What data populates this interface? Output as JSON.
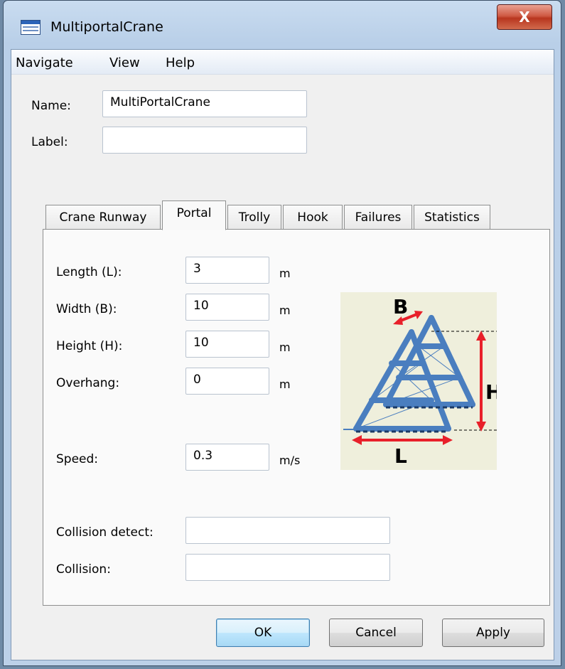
{
  "window": {
    "title": "MultiportalCrane",
    "close_glyph": "X",
    "icon": "window-app-icon"
  },
  "menu": [
    "Navigate",
    "View",
    "Help"
  ],
  "form": {
    "name_label": "Name:",
    "name_value": "MultiPortalCrane",
    "label_label": "Label:",
    "label_value": ""
  },
  "tabs": [
    "Crane Runway",
    "Portal",
    "Trolly",
    "Hook",
    "Failures",
    "Statistics"
  ],
  "active_tab": "Portal",
  "portal": {
    "length_label": "Length (L):",
    "length_value": "3",
    "length_unit": "m",
    "width_label": "Width (B):",
    "width_value": "10",
    "width_unit": "m",
    "height_label": "Height (H):",
    "height_value": "10",
    "height_unit": "m",
    "overhang_label": "Overhang:",
    "overhang_value": "0",
    "overhang_unit": "m",
    "speed_label": "Speed:",
    "speed_value": "0.3",
    "speed_unit": "m/s",
    "collision_detect_label": "Collision detect:",
    "collision_detect_value": "",
    "collision_label": "Collision:",
    "collision_value": ""
  },
  "diagram": {
    "label_b": "B",
    "label_h": "H",
    "label_l": "L",
    "colors": {
      "frame": "#4a7ebf",
      "arrow": "#e8202a",
      "background": "#efefdc"
    }
  },
  "buttons": {
    "ok": "OK",
    "cancel": "Cancel",
    "apply": "Apply"
  }
}
